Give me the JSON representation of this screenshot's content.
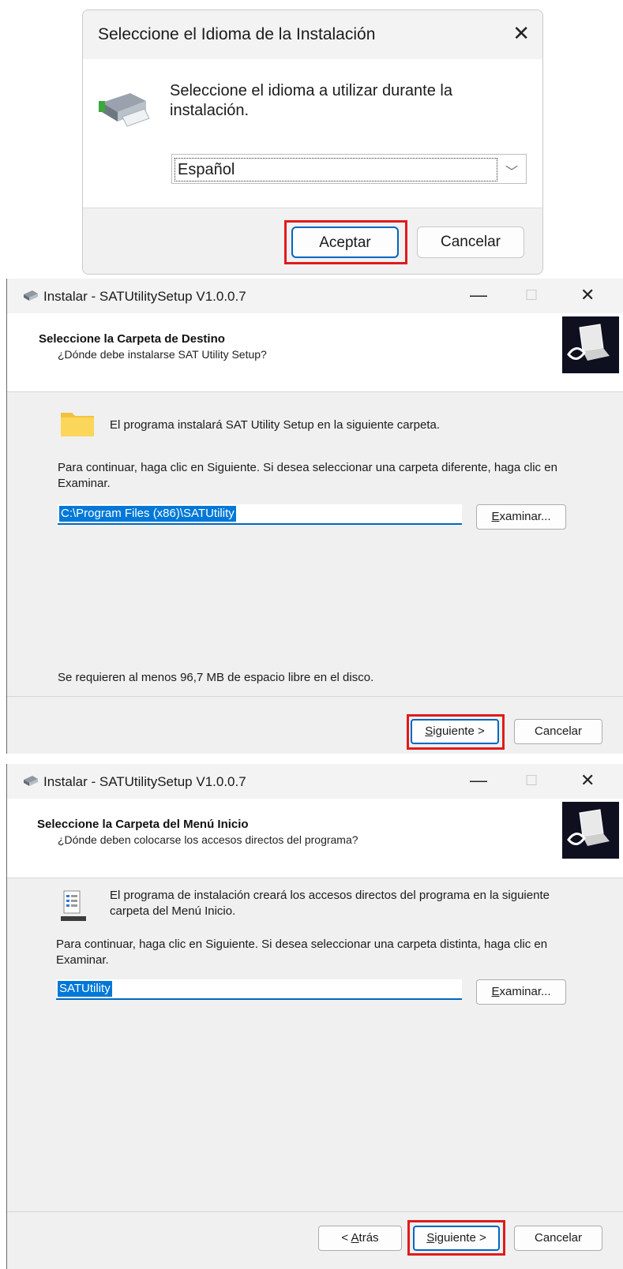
{
  "language_dialog": {
    "title": "Seleccione el Idioma de la Instalación",
    "prompt": "Seleccione el idioma a utilizar durante la instalación.",
    "selected_language": "Español",
    "accept_label": "Aceptar",
    "cancel_label": "Cancelar"
  },
  "destination_window": {
    "title": "Instalar - SATUtilitySetup V1.0.0.7",
    "heading": "Seleccione la Carpeta de Destino",
    "subheading": "¿Dónde debe instalarse SAT Utility Setup?",
    "info": "El programa instalará SAT Utility Setup en la siguiente carpeta.",
    "instructions": "Para continuar, haga clic en Siguiente. Si desea seleccionar una carpeta diferente, haga clic en Examinar.",
    "path_value": "C:\\Program Files (x86)\\SATUtility",
    "browse_label": "Examinar...",
    "space_required": "Se requieren al menos 96,7 MB de espacio libre en el disco.",
    "next_label": "Siguiente >",
    "cancel_label": "Cancelar"
  },
  "start_menu_window": {
    "title": "Instalar - SATUtilitySetup V1.0.0.7",
    "heading": "Seleccione la Carpeta del Menú Inicio",
    "subheading": "¿Dónde deben colocarse los accesos directos del programa?",
    "info": "El programa de instalación creará los accesos directos del programa en la siguiente carpeta del Menú Inicio.",
    "instructions": "Para continuar, haga clic en Siguiente. Si desea seleccionar una carpeta distinta, haga clic en Examinar.",
    "folder_value": "SATUtility",
    "browse_label": "Examinar...",
    "back_label": "< Atrás",
    "next_label": "Siguiente >",
    "cancel_label": "Cancelar"
  },
  "window_controls": {
    "minimize": "—",
    "maximize": "☐",
    "close": "✕"
  },
  "colors": {
    "accent": "#0067c0",
    "selection": "#0078d7",
    "highlight": "#e01b1b"
  }
}
